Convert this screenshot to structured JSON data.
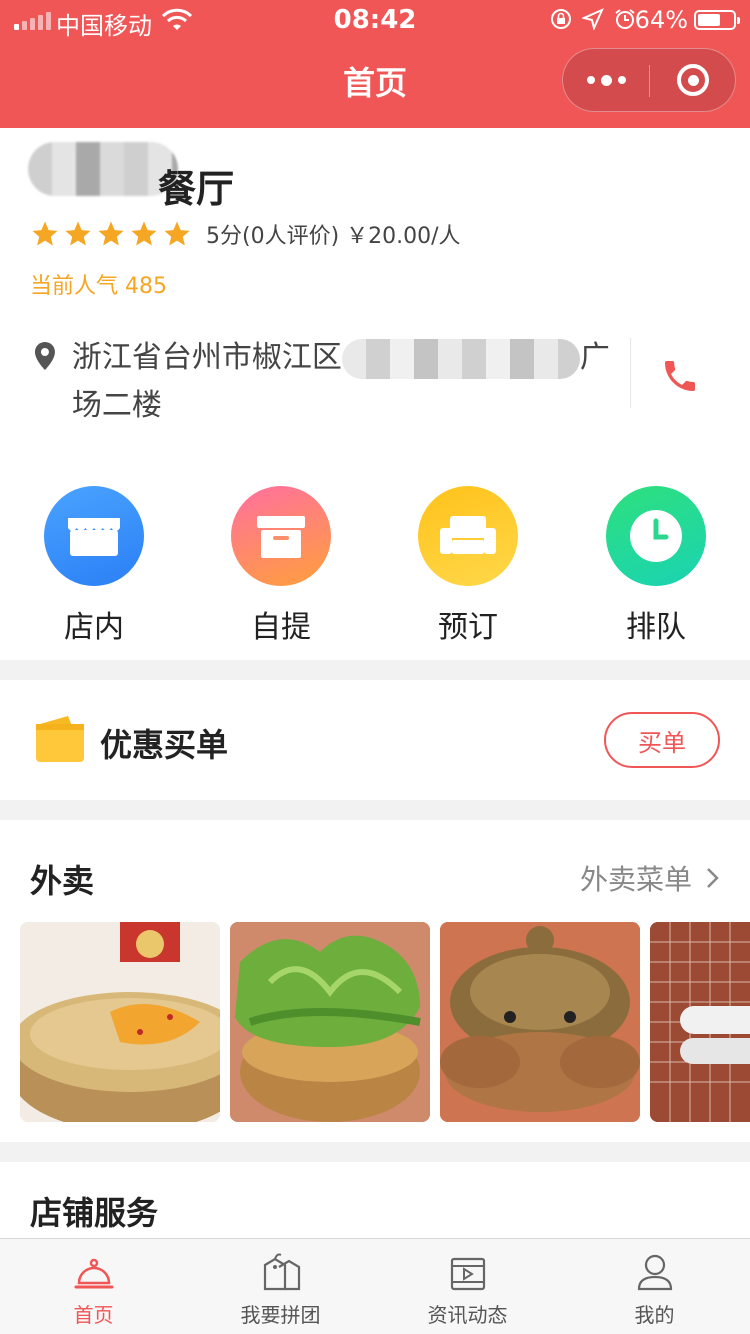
{
  "status_bar": {
    "carrier": "中国移动",
    "time": "08:42",
    "battery_pct": "64%",
    "battery_level": 0.64
  },
  "nav": {
    "title": "首页"
  },
  "store": {
    "name_visible": "餐厅",
    "stars": 5,
    "rating_text": "5分(0人评价)  ￥20.00/人",
    "popularity_label": "当前人气",
    "popularity_value": "485",
    "address_part1": "浙江省台州市椒江区",
    "address_part2": "广",
    "address_line2": "场二楼"
  },
  "services": [
    {
      "label": "店内",
      "icon": "store-icon"
    },
    {
      "label": "自提",
      "icon": "box-icon"
    },
    {
      "label": "预订",
      "icon": "sofa-icon"
    },
    {
      "label": "排队",
      "icon": "clock-icon"
    }
  ],
  "coupon": {
    "title": "优惠买单",
    "button": "买单"
  },
  "takeout": {
    "title": "外卖",
    "menu_link": "外卖菜单",
    "photos": [
      "soup-dish",
      "lettuce-dish",
      "crab-pot-dish",
      "rice-cake-dish"
    ]
  },
  "shop_services": {
    "title": "店铺服务"
  },
  "tabbar": [
    {
      "label": "首页",
      "icon": "cloche-icon",
      "active": true
    },
    {
      "label": "我要拼团",
      "icon": "tags-icon",
      "active": false
    },
    {
      "label": "资讯动态",
      "icon": "video-icon",
      "active": false
    },
    {
      "label": "我的",
      "icon": "user-icon",
      "active": false
    }
  ],
  "colors": {
    "brand": "#f15657",
    "popularity": "#f5a623",
    "star": "#f5a623"
  }
}
